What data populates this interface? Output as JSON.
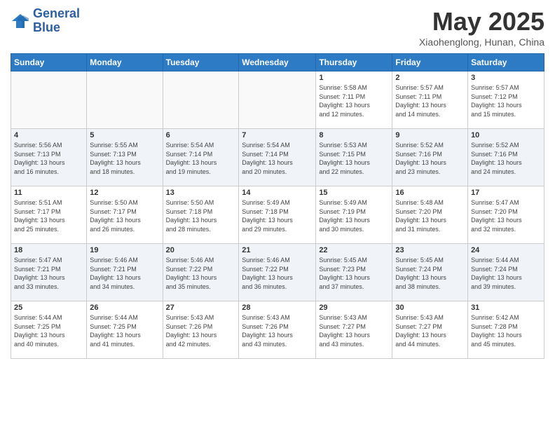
{
  "header": {
    "logo_line1": "General",
    "logo_line2": "Blue",
    "month_title": "May 2025",
    "location": "Xiaohenglong, Hunan, China"
  },
  "days_of_week": [
    "Sunday",
    "Monday",
    "Tuesday",
    "Wednesday",
    "Thursday",
    "Friday",
    "Saturday"
  ],
  "weeks": [
    [
      {
        "day": "",
        "info": ""
      },
      {
        "day": "",
        "info": ""
      },
      {
        "day": "",
        "info": ""
      },
      {
        "day": "",
        "info": ""
      },
      {
        "day": "1",
        "info": "Sunrise: 5:58 AM\nSunset: 7:11 PM\nDaylight: 13 hours\nand 12 minutes."
      },
      {
        "day": "2",
        "info": "Sunrise: 5:57 AM\nSunset: 7:11 PM\nDaylight: 13 hours\nand 14 minutes."
      },
      {
        "day": "3",
        "info": "Sunrise: 5:57 AM\nSunset: 7:12 PM\nDaylight: 13 hours\nand 15 minutes."
      }
    ],
    [
      {
        "day": "4",
        "info": "Sunrise: 5:56 AM\nSunset: 7:13 PM\nDaylight: 13 hours\nand 16 minutes."
      },
      {
        "day": "5",
        "info": "Sunrise: 5:55 AM\nSunset: 7:13 PM\nDaylight: 13 hours\nand 18 minutes."
      },
      {
        "day": "6",
        "info": "Sunrise: 5:54 AM\nSunset: 7:14 PM\nDaylight: 13 hours\nand 19 minutes."
      },
      {
        "day": "7",
        "info": "Sunrise: 5:54 AM\nSunset: 7:14 PM\nDaylight: 13 hours\nand 20 minutes."
      },
      {
        "day": "8",
        "info": "Sunrise: 5:53 AM\nSunset: 7:15 PM\nDaylight: 13 hours\nand 22 minutes."
      },
      {
        "day": "9",
        "info": "Sunrise: 5:52 AM\nSunset: 7:16 PM\nDaylight: 13 hours\nand 23 minutes."
      },
      {
        "day": "10",
        "info": "Sunrise: 5:52 AM\nSunset: 7:16 PM\nDaylight: 13 hours\nand 24 minutes."
      }
    ],
    [
      {
        "day": "11",
        "info": "Sunrise: 5:51 AM\nSunset: 7:17 PM\nDaylight: 13 hours\nand 25 minutes."
      },
      {
        "day": "12",
        "info": "Sunrise: 5:50 AM\nSunset: 7:17 PM\nDaylight: 13 hours\nand 26 minutes."
      },
      {
        "day": "13",
        "info": "Sunrise: 5:50 AM\nSunset: 7:18 PM\nDaylight: 13 hours\nand 28 minutes."
      },
      {
        "day": "14",
        "info": "Sunrise: 5:49 AM\nSunset: 7:18 PM\nDaylight: 13 hours\nand 29 minutes."
      },
      {
        "day": "15",
        "info": "Sunrise: 5:49 AM\nSunset: 7:19 PM\nDaylight: 13 hours\nand 30 minutes."
      },
      {
        "day": "16",
        "info": "Sunrise: 5:48 AM\nSunset: 7:20 PM\nDaylight: 13 hours\nand 31 minutes."
      },
      {
        "day": "17",
        "info": "Sunrise: 5:47 AM\nSunset: 7:20 PM\nDaylight: 13 hours\nand 32 minutes."
      }
    ],
    [
      {
        "day": "18",
        "info": "Sunrise: 5:47 AM\nSunset: 7:21 PM\nDaylight: 13 hours\nand 33 minutes."
      },
      {
        "day": "19",
        "info": "Sunrise: 5:46 AM\nSunset: 7:21 PM\nDaylight: 13 hours\nand 34 minutes."
      },
      {
        "day": "20",
        "info": "Sunrise: 5:46 AM\nSunset: 7:22 PM\nDaylight: 13 hours\nand 35 minutes."
      },
      {
        "day": "21",
        "info": "Sunrise: 5:46 AM\nSunset: 7:22 PM\nDaylight: 13 hours\nand 36 minutes."
      },
      {
        "day": "22",
        "info": "Sunrise: 5:45 AM\nSunset: 7:23 PM\nDaylight: 13 hours\nand 37 minutes."
      },
      {
        "day": "23",
        "info": "Sunrise: 5:45 AM\nSunset: 7:24 PM\nDaylight: 13 hours\nand 38 minutes."
      },
      {
        "day": "24",
        "info": "Sunrise: 5:44 AM\nSunset: 7:24 PM\nDaylight: 13 hours\nand 39 minutes."
      }
    ],
    [
      {
        "day": "25",
        "info": "Sunrise: 5:44 AM\nSunset: 7:25 PM\nDaylight: 13 hours\nand 40 minutes."
      },
      {
        "day": "26",
        "info": "Sunrise: 5:44 AM\nSunset: 7:25 PM\nDaylight: 13 hours\nand 41 minutes."
      },
      {
        "day": "27",
        "info": "Sunrise: 5:43 AM\nSunset: 7:26 PM\nDaylight: 13 hours\nand 42 minutes."
      },
      {
        "day": "28",
        "info": "Sunrise: 5:43 AM\nSunset: 7:26 PM\nDaylight: 13 hours\nand 43 minutes."
      },
      {
        "day": "29",
        "info": "Sunrise: 5:43 AM\nSunset: 7:27 PM\nDaylight: 13 hours\nand 43 minutes."
      },
      {
        "day": "30",
        "info": "Sunrise: 5:43 AM\nSunset: 7:27 PM\nDaylight: 13 hours\nand 44 minutes."
      },
      {
        "day": "31",
        "info": "Sunrise: 5:42 AM\nSunset: 7:28 PM\nDaylight: 13 hours\nand 45 minutes."
      }
    ]
  ]
}
